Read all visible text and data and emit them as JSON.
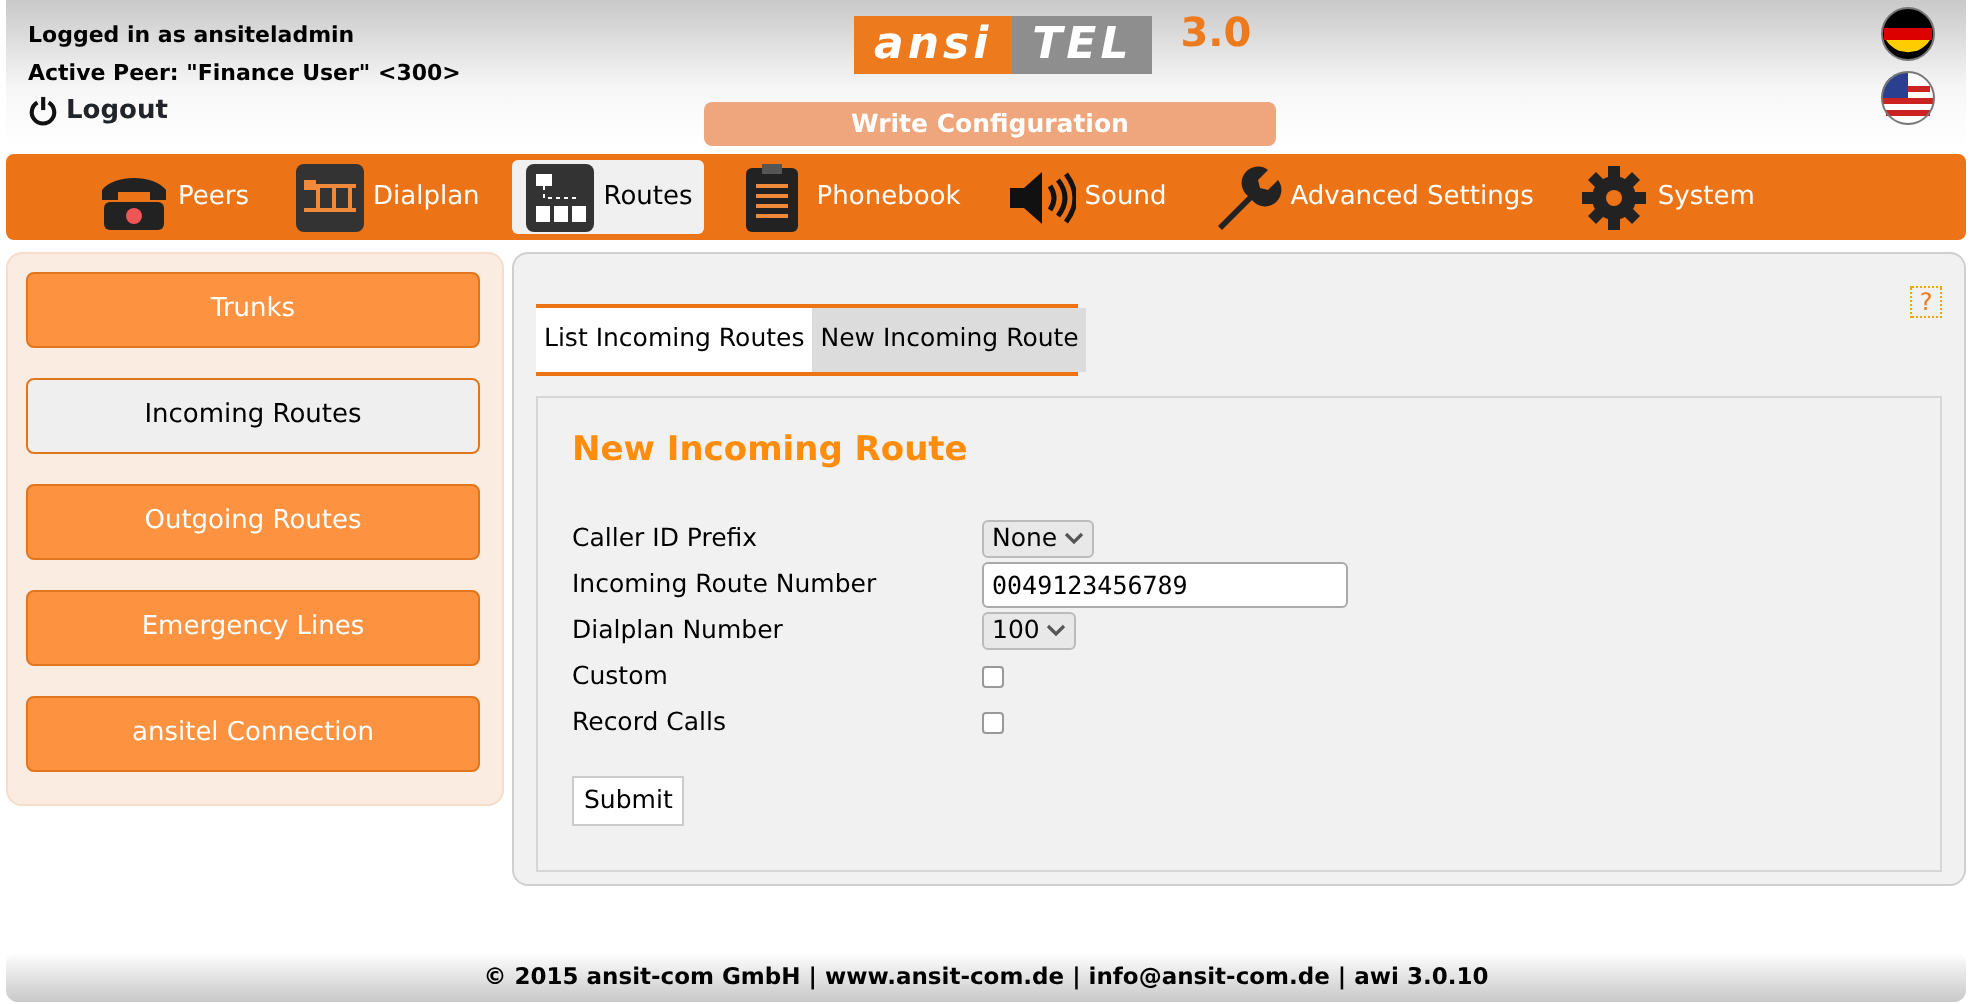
{
  "header": {
    "logged_in": "Logged in as ansiteladmin",
    "active_peer": "Active Peer: \"Finance User\" <300>",
    "logout": "Logout",
    "logo": {
      "part_1": "ansi",
      "part_2": "TEL",
      "version": "3.0"
    },
    "write_configuration": "Write Configuration",
    "languages": [
      {
        "kind": "de"
      },
      {
        "kind": "us"
      }
    ]
  },
  "nav": [
    {
      "label": "Peers",
      "kind": "phone",
      "selected": false
    },
    {
      "label": "Dialplan",
      "kind": "dialplan",
      "selected": false
    },
    {
      "label": "Routes",
      "kind": "routes",
      "selected": true
    },
    {
      "label": "Phonebook",
      "kind": "phonebook",
      "selected": false
    },
    {
      "label": "Sound",
      "kind": "sound",
      "selected": false
    },
    {
      "label": "Advanced Settings",
      "kind": "wrench",
      "selected": false
    },
    {
      "label": "System",
      "kind": "gear",
      "selected": false
    }
  ],
  "sidebar": {
    "items": [
      {
        "label": "Trunks",
        "selected": false
      },
      {
        "label": "Incoming Routes",
        "selected": true
      },
      {
        "label": "Outgoing Routes",
        "selected": false
      },
      {
        "label": "Emergency Lines",
        "selected": false
      },
      {
        "label": "ansitel Connection",
        "selected": false
      }
    ]
  },
  "content": {
    "help": "?",
    "tabs": [
      {
        "label": "List Incoming Routes",
        "selected": false
      },
      {
        "label": "New Incoming Route",
        "selected": true
      }
    ],
    "form": {
      "title": "New Incoming Route",
      "fields": [
        {
          "label": "Caller ID Prefix",
          "kind": "select",
          "value": "None"
        },
        {
          "label": "Incoming Route Number",
          "kind": "text",
          "value": "0049123456789"
        },
        {
          "label": "Dialplan Number",
          "kind": "select",
          "value": "100"
        },
        {
          "label": "Custom",
          "kind": "checkbox",
          "checked": false
        },
        {
          "label": "Record Calls",
          "kind": "checkbox",
          "checked": false
        }
      ],
      "submit": "Submit"
    }
  },
  "footer": "© 2015 ansit-com GmbH | www.ansit-com.de | info@ansit-com.de | awi 3.0.10"
}
